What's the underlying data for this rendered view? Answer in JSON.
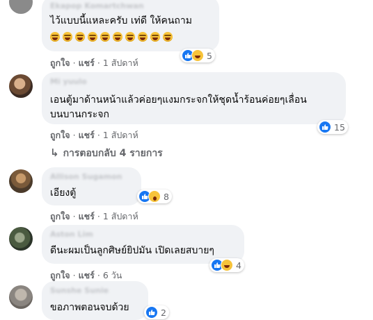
{
  "comments": [
    {
      "name": "Ekapop Komartchwan",
      "lines": [
        "ไว้แบบนี้แหละครับ เท่ดี ให้คนถาม"
      ],
      "emoji_count": 10,
      "actions": {
        "like": "ถูกใจ",
        "reply": "แชร์",
        "time": "1 สัปดาห์"
      },
      "reactions": {
        "icons": [
          "like-icon",
          "haha-icon"
        ],
        "count": "5"
      }
    },
    {
      "name": "Mi yuulo",
      "lines": [
        "เอนตู้มาด้านหน้าแล้วค่อยๆแงมกระจกให้ชุดน้ำร้อนค่อยๆเลื่อน",
        "บนบานกระจก"
      ],
      "actions": {
        "like": "ถูกใจ",
        "reply": "แชร์",
        "time": "1 สัปดาห์"
      },
      "reactions": {
        "icons": [
          "like-icon"
        ],
        "count": "15"
      }
    },
    {
      "name": "Allison Sugamon",
      "lines": [
        "เอียงตู้"
      ],
      "actions": {
        "like": "ถูกใจ",
        "reply": "แชร์",
        "time": "1 สัปดาห์"
      },
      "reactions": {
        "icons": [
          "like-icon",
          "wow-icon"
        ],
        "count": "8"
      }
    },
    {
      "name": "Aston Lim",
      "lines": [
        "ดีนะผมเป็นลูกศิษย์ยิปมัน เปิดเลยสบายๆ"
      ],
      "actions": {
        "like": "ถูกใจ",
        "reply": "แชร์",
        "time": "6 วัน"
      },
      "reactions": {
        "icons": [
          "like-icon",
          "haha-icon"
        ],
        "count": "4"
      }
    },
    {
      "name": "Sunshe Sunie",
      "lines": [
        "ขอภาพตอนจบด้วย"
      ],
      "reactions": {
        "icons": [
          "like-icon"
        ],
        "count": "2"
      }
    }
  ],
  "replies_link": {
    "label": "การตอบกลับ 4 รายการ"
  },
  "colors": {
    "bubble": "#f0f2f5",
    "like": "#1877f2",
    "meta": "#65676b"
  }
}
